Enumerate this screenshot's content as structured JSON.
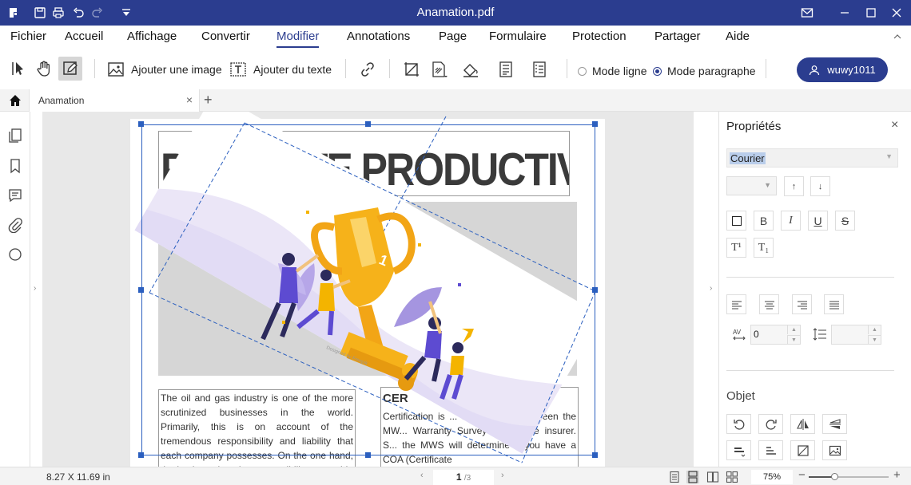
{
  "window": {
    "title": "Anamation.pdf"
  },
  "menu": {
    "items": [
      "Fichier",
      "Accueil",
      "Affichage",
      "Convertir",
      "Modifier",
      "Annotations",
      "Page",
      "Formulaire",
      "Protection",
      "Partager",
      "Aide"
    ],
    "active": "Modifier"
  },
  "toolbar": {
    "add_image": "Ajouter une image",
    "add_text": "Ajouter du texte",
    "mode_line": "Mode ligne",
    "mode_paragraph": "Mode paragraphe",
    "selected_mode": "Mode paragraphe",
    "user": "wuwy1011"
  },
  "tabs": [
    {
      "label": "Anamation"
    }
  ],
  "document": {
    "headline": "PROMOTE PRODUCTIVITY",
    "body_left": "The oil and gas industry is one of the more scrutinized businesses in the world. Primarily, this is on account of the tremendous responsibility and liability that each company possesses. On the one hand, the business has the responsibility to provide the oil and gas",
    "right_heading": "CER",
    "body_right": "Certification is ... forth of fixes between the MW... Warranty Surveyor) and the insurer. S... the MWS will determine if you have a COA (Certificate",
    "image_watermark": "Designed by Freepik"
  },
  "properties": {
    "title": "Propriétés",
    "font": "Courier",
    "char_spacing": "0",
    "object_section": "Objet"
  },
  "status": {
    "dimensions": "8.27 X 11.69 in",
    "current_page": "1",
    "total_pages": "/3",
    "zoom": "75%",
    "zoom_fraction": 0.32
  },
  "colors": {
    "brand": "#2b3d8f",
    "selection": "#2b5fbf",
    "trophy": "#f4b400"
  }
}
